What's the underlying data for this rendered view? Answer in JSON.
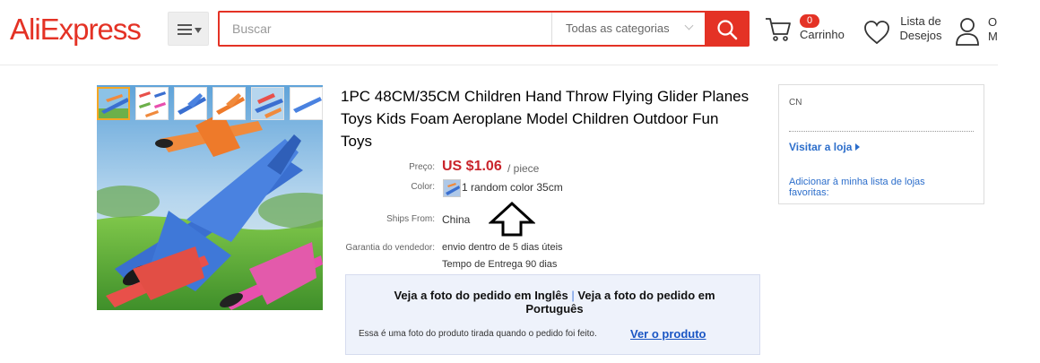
{
  "header": {
    "logo_text": "AliExpress",
    "search_placeholder": "Buscar",
    "category_label": "Todas as categorias",
    "cart_count": "0",
    "cart_label": "Carrinho",
    "wishlist_line1": "Lista de",
    "wishlist_line2": "Desejos",
    "account_line1": "O",
    "account_line2": "M",
    "accent_color": "#e43225"
  },
  "product": {
    "title": "1PC 48CM/35CM Children Hand Throw Flying Glider Planes Toys Kids Foam Aeroplane Model Children Outdoor Fun Toys",
    "price_label": "Preço:",
    "price": "US $1.06",
    "price_unit": "/ piece",
    "color_label": "Color:",
    "color_value": "1 random color 35cm",
    "ships_label": "Ships From:",
    "ships_value": "China",
    "guarantee_label": "Garantia do vendedor:",
    "guarantee_line1": "envio dentro de 5 dias úteis",
    "guarantee_line2": "Tempo de Entrega 90 dias",
    "price_color": "#c9242b"
  },
  "photo_box": {
    "title_part1": "Veja a foto do pedido em Inglês",
    "separator": "|",
    "title_part2": "Veja a foto do pedido em Português",
    "description": "Essa é uma foto do produto tirada quando o pedido foi feito.",
    "link": "Ver o produto"
  },
  "store": {
    "country": "CN",
    "visit_label": "Visitar a loja",
    "favorite_label": "Adicionar à minha lista de lojas favoritas:"
  },
  "icons": {
    "menu": "hamburger-menu-icon",
    "search": "search-icon",
    "cart": "cart-icon",
    "wishlist": "heart-icon",
    "account": "user-icon",
    "annotation": "up-arrow-icon"
  }
}
